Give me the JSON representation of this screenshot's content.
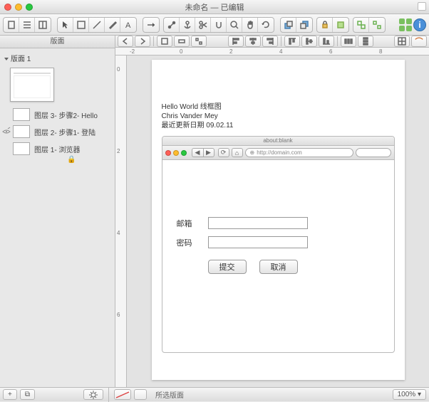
{
  "window": {
    "title": "未命名 — 已编辑"
  },
  "sidebar": {
    "header": "版面",
    "page_node": "版面 1",
    "layers": [
      {
        "label": "图层 3- 步骤2- Hello",
        "has_eye": false,
        "locked": false
      },
      {
        "label": "图层 2- 步骤1- 登陆",
        "has_eye": true,
        "locked": false
      },
      {
        "label": "图层 1- 浏览器",
        "has_eye": false,
        "locked": true
      }
    ],
    "lock_glyph": "🔒"
  },
  "ruler_h": [
    "-2",
    "0",
    "2",
    "4",
    "6",
    "8"
  ],
  "ruler_v": [
    "0",
    "2",
    "4",
    "6"
  ],
  "doc": {
    "line1": "Hello World 线框图",
    "line2": "Chris Vander Mey",
    "line3": "最近更新日期 09.02.11",
    "browser": {
      "tab_title": "about:blank",
      "url_prefix": "⊕",
      "url": "http://domain.com",
      "nav_back": "◀",
      "nav_fwd": "▶",
      "form": {
        "email_label": "邮箱",
        "password_label": "密码",
        "submit": "提交",
        "cancel": "取消"
      }
    }
  },
  "statusbar": {
    "add": "+",
    "add2": "⧉",
    "sel_label": "所选版面",
    "zoom": "100%"
  },
  "toolbar2": {
    "magnet": "⌒"
  }
}
